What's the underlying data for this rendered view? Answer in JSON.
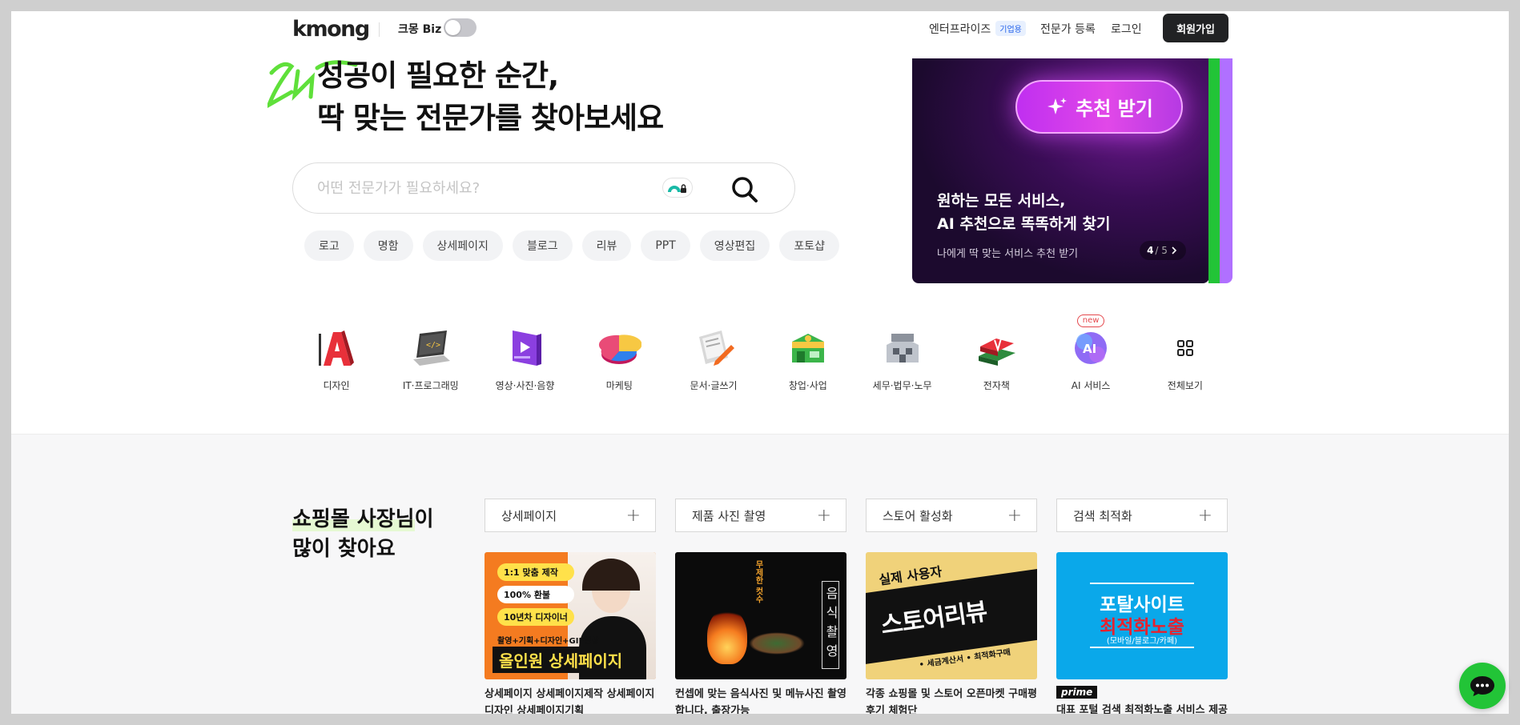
{
  "header": {
    "logo": "kmong",
    "biz_label": "크몽 Biz",
    "nav": {
      "enterprise": "엔터프라이즈",
      "enterprise_badge": "기업용",
      "register_expert": "전문가 등록",
      "login": "로그인",
      "signup": "회원가입"
    }
  },
  "hero": {
    "title_line1": "성공이 필요한 순간,",
    "title_line2": "딱 맞는 전문가를 찾아보세요",
    "search_placeholder": "어떤 전문가가 필요하세요?",
    "chips": [
      "로고",
      "명함",
      "상세페이지",
      "블로그",
      "리뷰",
      "PPT",
      "영상편집",
      "포토샵"
    ]
  },
  "banner": {
    "button_label": "추천 받기",
    "title_line1": "원하는 모든 서비스,",
    "title_line2": "AI 추천으로 똑똑하게 찾기",
    "subtitle": "나에게 딱 맞는 서비스 추천 받기",
    "pager_current": "4",
    "pager_total": "/ 5"
  },
  "categories": [
    {
      "label": "디자인",
      "icon": "design-icon"
    },
    {
      "label": "IT·프로그래밍",
      "icon": "laptop-icon"
    },
    {
      "label": "영상·사진·음향",
      "icon": "video-icon"
    },
    {
      "label": "마케팅",
      "icon": "pie-chart-icon"
    },
    {
      "label": "문서·글쓰기",
      "icon": "document-icon"
    },
    {
      "label": "창업·사업",
      "icon": "store-icon"
    },
    {
      "label": "세무·법무·노무",
      "icon": "building-icon"
    },
    {
      "label": "전자책",
      "icon": "books-icon"
    },
    {
      "label": "AI 서비스",
      "icon": "ai-icon",
      "badge": "new"
    },
    {
      "label": "전체보기",
      "icon": "grid-icon"
    }
  ],
  "shop": {
    "title_hl": "쇼핑몰 사장님",
    "title_rest": "이",
    "title_line2": "많이 찾아요",
    "tags": [
      "상세페이지",
      "제품 사진 촬영",
      "스토어 활성화",
      "검색 최적화"
    ],
    "cards": [
      {
        "title": "상세페이지 상세페이지제작 상세페이지 디자인 상세페이지기획",
        "thumb_badges": [
          "1:1 맞춤 제작",
          "100% 환불",
          "10년차 디자이너"
        ],
        "thumb_caption": "촬영+기획+디자인+GIF영상",
        "thumb_headline": "올인원 상세페이지"
      },
      {
        "title": "컨셉에 맞는 음식사진 및 메뉴사진 촬영합니다. 출장가능",
        "thumb_small": "무제한 컷수",
        "thumb_headline": "음식촬영"
      },
      {
        "title": "각종 쇼핑몰 및 스토어 오픈마켓 구매평 후기 체험단",
        "thumb_top": "실제 사용자",
        "thumb_headline": "스토어리뷰",
        "thumb_bottom": "• 세금계산서 • 최적화구매"
      },
      {
        "title": "대표 포털 검색 최적화노출 서비스 제공",
        "prime": "prime",
        "thumb_line1": "포탈사이트",
        "thumb_line2": "최적화노출",
        "thumb_line3": "(모바일/블로그/카페)"
      }
    ]
  },
  "colors": {
    "brand_green": "#22c437",
    "dark": "#212224",
    "banner_purple": "#b070ff"
  }
}
